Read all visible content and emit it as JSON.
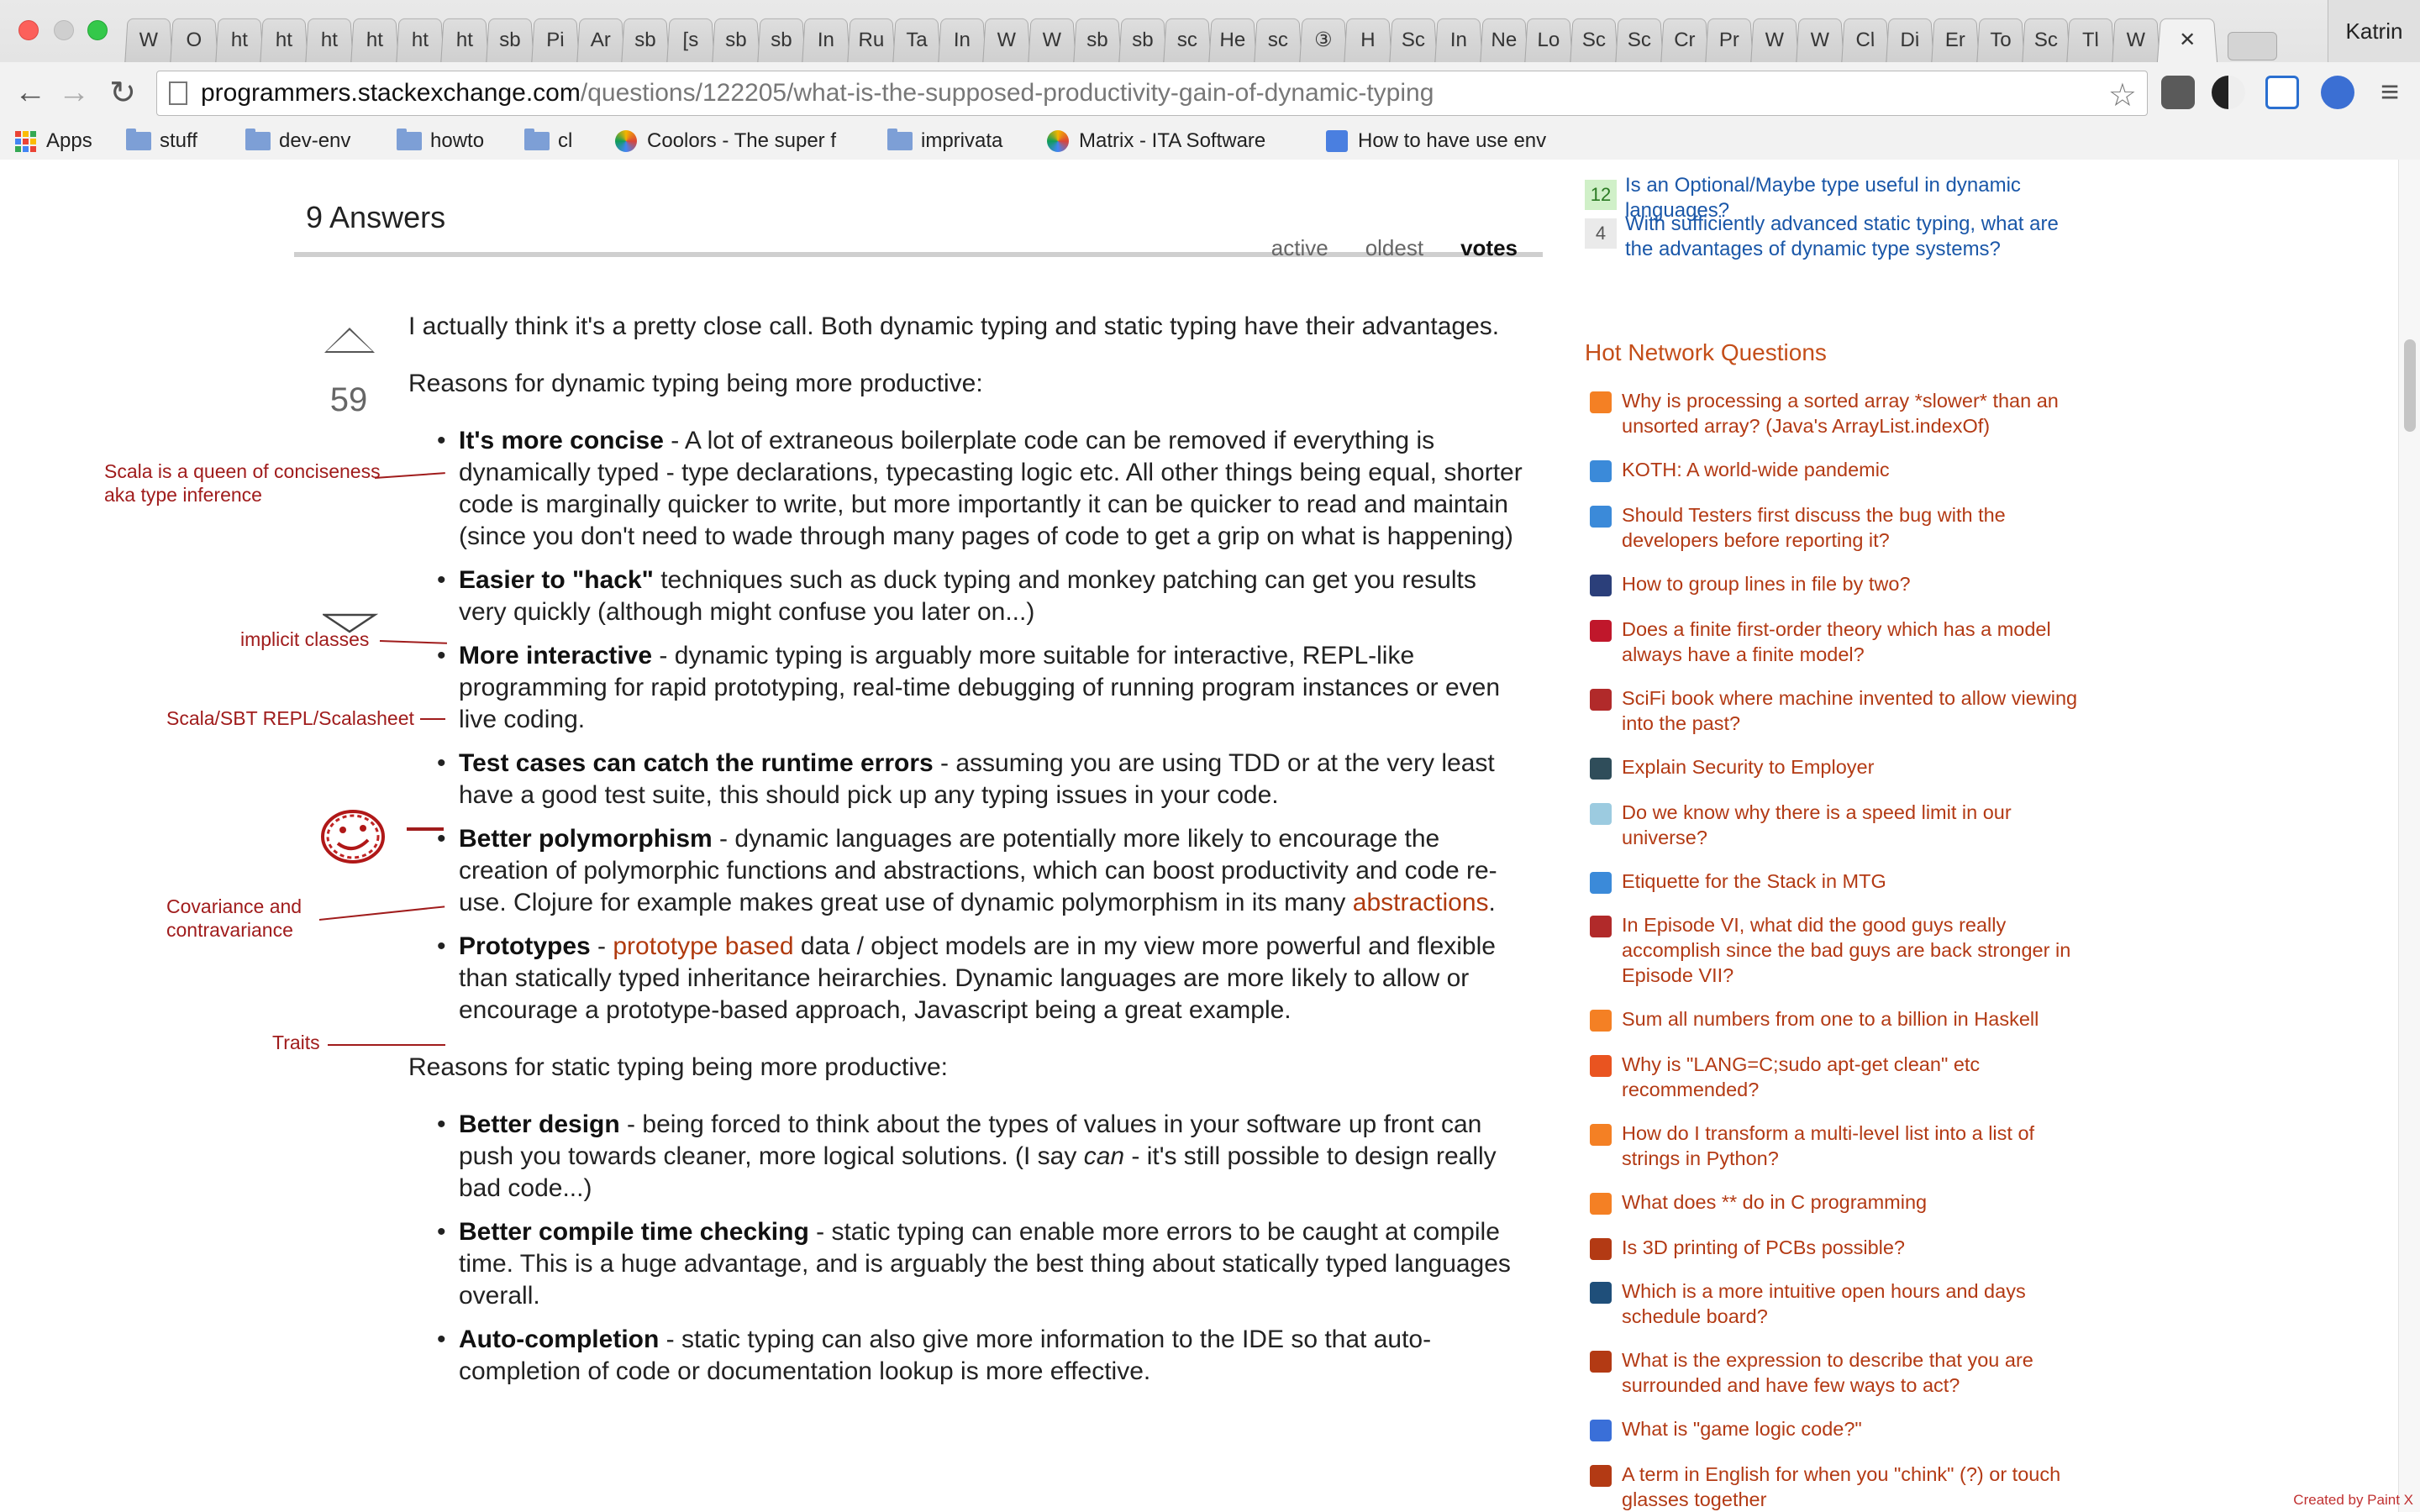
{
  "browser": {
    "tabs": [
      "W",
      "O",
      "ht",
      "ht",
      "ht",
      "ht",
      "ht",
      "ht",
      "sb",
      "Pi",
      "Ar",
      "sb",
      "[s",
      "sb",
      "sb",
      "In",
      "Ru",
      "Ta",
      "In",
      "W",
      "W",
      "sb",
      "sb",
      "sc",
      "He",
      "sc",
      "③",
      "H",
      "Sc",
      "In",
      "Ne",
      "Lo",
      "Sc",
      "Sc",
      "Cr",
      "Pr",
      "W",
      "W",
      "Cl",
      "Di",
      "Er",
      "To",
      "Sc",
      "Tl",
      "W"
    ],
    "active_tab_close": "✕",
    "profile_name": "Katrin",
    "url_host": "programmers.stackexchange.com",
    "url_path": "/questions/122205/what-is-the-supposed-productivity-gain-of-dynamic-typing",
    "back_icon": "←",
    "forward_icon": "→",
    "reload_icon": "↻",
    "star_icon": "☆",
    "menu_icon": "≡",
    "bookmarks": [
      {
        "label": "Apps",
        "kind": "apps"
      },
      {
        "label": "stuff",
        "kind": "folder"
      },
      {
        "label": "dev-env",
        "kind": "folder"
      },
      {
        "label": "howto",
        "kind": "folder"
      },
      {
        "label": "cl",
        "kind": "folder"
      },
      {
        "label": "Coolors - The super f",
        "kind": "site"
      },
      {
        "label": "imprivata",
        "kind": "folder"
      },
      {
        "label": "Matrix - ITA Software",
        "kind": "site"
      },
      {
        "label": "How to have use env",
        "kind": "doc"
      }
    ]
  },
  "answers": {
    "count_label": "9 Answers",
    "sort_tabs": [
      "active",
      "oldest",
      "votes"
    ],
    "active_sort": "votes",
    "vote_count": "59"
  },
  "post": {
    "intro": "I actually think it's a pretty close call. Both dynamic typing and static typing have their advantages.",
    "dynamic_heading": "Reasons for dynamic typing being more productive:",
    "dynamic_items": [
      {
        "bold": "It's more concise",
        "text": " - A lot of extraneous boilerplate code can be removed if everything is dynamically typed - type declarations, typecasting logic etc. All other things being equal, shorter code is marginally quicker to write, but more importantly it can be quicker to read and maintain (since you don't need to wade through many pages of code to get a grip on what is happening)"
      },
      {
        "bold": "Easier to \"hack\"",
        "text": " techniques such as duck typing and monkey patching can get you results very quickly (although might confuse you later on...)"
      },
      {
        "bold": "More interactive",
        "text": " - dynamic typing is arguably more suitable for interactive, REPL-like programming for rapid prototyping, real-time debugging of running program instances or even live coding."
      },
      {
        "bold": "Test cases can catch the runtime errors",
        "text": " - assuming you are using TDD or at the very least have a good test suite, this should pick up any typing issues in your code."
      },
      {
        "bold": "Better polymorphism",
        "text": " - dynamic languages are potentially more likely to encourage the creation of polymorphic functions and abstractions, which can boost productivity and code re-use. Clojure for example makes great use of dynamic polymorphism in its many ",
        "link": "abstractions",
        "after": "."
      },
      {
        "bold": "Prototypes",
        "text_before": " - ",
        "link": "prototype based",
        "text": " data / object models are in my view more powerful and flexible than statically typed inheritance heirarchies. Dynamic languages are more likely to allow or encourage a prototype-based approach, Javascript being a great example."
      }
    ],
    "static_heading": "Reasons for static typing being more productive:",
    "static_items": [
      {
        "bold": "Better design",
        "text": " - being forced to think about the types of values in your software up front can push you towards cleaner, more logical solutions. (I say ",
        "italic": "can",
        "after": " - it's still possible to design really bad code...)"
      },
      {
        "bold": "Better compile time checking",
        "text": " - static typing can enable more errors to be caught at compile time. This is a huge advantage, and is arguably the best thing about statically typed languages overall."
      },
      {
        "bold": "Auto-completion",
        "text": " - static typing can also give more information to the IDE so that auto-completion of code or documentation lookup is more effective."
      }
    ]
  },
  "annotations": {
    "concise": "Scala is a queen of conciseness aka type inference",
    "hack": "implicit classes",
    "interactive": "Scala/SBT REPL/Scalasheet",
    "polymorphism": "Covariance and contravariance",
    "prototypes": "Traits"
  },
  "sidebar": {
    "linked": [
      {
        "count": "12",
        "title": "Is an Optional/Maybe type useful in dynamic languages?",
        "highlight": true
      },
      {
        "count": "4",
        "title": "With sufficiently advanced static typing, what are the advantages of dynamic type systems?",
        "highlight": false
      }
    ],
    "hnq_heading": "Hot Network Questions",
    "hnq": [
      {
        "title": "Why is processing a sorted array *slower* than an unsorted array? (Java's ArrayList.indexOf)",
        "icon": "stackoverflow",
        "color": "#f48024"
      },
      {
        "title": "KOTH: A world-wide pandemic",
        "icon": "PCG",
        "color": "#3b8ad9"
      },
      {
        "title": "Should Testers first discuss the bug with the developers before reporting it?",
        "icon": "QA",
        "color": "#3b8ad9"
      },
      {
        "title": "How to group lines in file by two?",
        "icon": "U&L",
        "color": "#2b3f7a"
      },
      {
        "title": "Does a finite first-order theory which has a model always have a finite model?",
        "icon": "math",
        "color": "#c0172b"
      },
      {
        "title": "SciFi book where machine invented to allow viewing into the past?",
        "icon": "scifi",
        "color": "#b12a2a"
      },
      {
        "title": "Explain Security to Employer",
        "icon": "security",
        "color": "#2f4d5a"
      },
      {
        "title": "Do we know why there is a speed limit in our universe?",
        "icon": "physics",
        "color": "#9ccbe0"
      },
      {
        "title": "Etiquette for the Stack in MTG",
        "icon": "BG",
        "color": "#3b8ad9"
      },
      {
        "title": "In Episode VI, what did the good guys really accomplish since the bad guys are back stronger in Episode VII?",
        "icon": "scifi",
        "color": "#b12a2a"
      },
      {
        "title": "Sum all numbers from one to a billion in Haskell",
        "icon": "stackoverflow",
        "color": "#f48024"
      },
      {
        "title": "Why is \"LANG=C;sudo apt-get clean\" etc recommended?",
        "icon": "ask",
        "color": "#e95420"
      },
      {
        "title": "How do I transform a multi-level list into a list of strings in Python?",
        "icon": "stackoverflow",
        "color": "#f48024"
      },
      {
        "title": "What does ** do in C programming",
        "icon": "stackoverflow",
        "color": "#f48024"
      },
      {
        "title": "Is 3D printing of PCBs possible?",
        "icon": "electronics",
        "color": "#b33a14"
      },
      {
        "title": "Which is a more intuitive open hours and days schedule board?",
        "icon": "UX",
        "color": "#1f4f7a"
      },
      {
        "title": "What is the expression to describe that you are surrounded and have few ways to act?",
        "icon": "ell",
        "color": "#b33a14"
      },
      {
        "title": "What is \"game logic code?\"",
        "icon": "gamedev",
        "color": "#3a6fd8"
      },
      {
        "title": "A term in English for when you \"chink\" (?) or touch glasses together",
        "icon": "ell",
        "color": "#b33a14"
      }
    ]
  },
  "footer_credit": "Created by Paint X"
}
